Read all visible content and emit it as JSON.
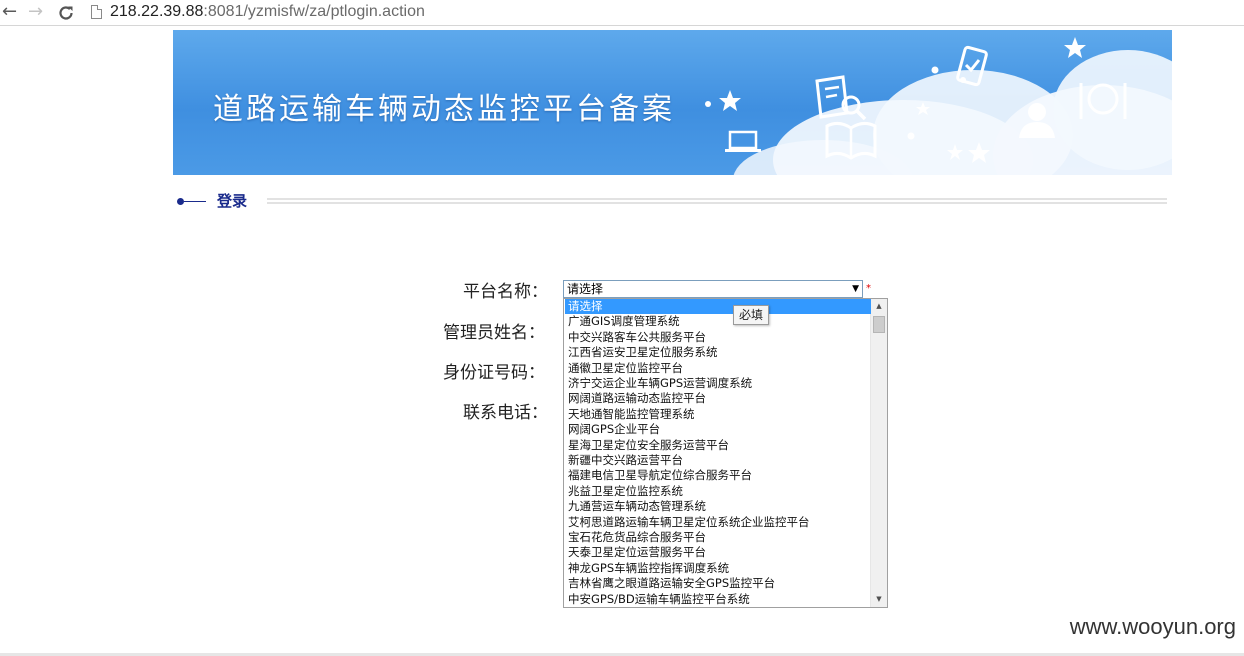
{
  "browser": {
    "url_host": "218.22.39.88",
    "url_rest": ":8081/yzmisfw/za/ptlogin.action",
    "back_icon": "arrow-left-icon",
    "forward_icon": "arrow-right-icon",
    "reload_icon": "reload-icon",
    "page_icon": "document-icon"
  },
  "banner": {
    "title": "道路运输车辆动态监控平台备案",
    "icons": [
      "star-icon",
      "laptop-icon",
      "book-icon",
      "document-search-icon",
      "phone-check-icon",
      "user-icon",
      "dining-icon"
    ]
  },
  "section": {
    "title": "登录"
  },
  "form": {
    "platform_label": "平台名称：",
    "admin_label": "管理员姓名：",
    "id_label": "身份证号码：",
    "phone_label": "联系电话：",
    "select_value": "请选择",
    "required_mark": "*",
    "tooltip": "必填",
    "options": [
      "请选择",
      "广通GIS调度管理系统",
      "中交兴路客车公共服务平台",
      "江西省运安卫星定位服务系统",
      "通徽卫星定位监控平台",
      "济宁交运企业车辆GPS运营调度系统",
      "网阔道路运输动态监控平台",
      "天地通智能监控管理系统",
      "网阔GPS企业平台",
      "星海卫星定位安全服务运营平台",
      "新疆中交兴路运营平台",
      "福建电信卫星导航定位综合服务平台",
      "兆益卫星定位监控系统",
      "九通营运车辆动态管理系统",
      "艾柯思道路运输车辆卫星定位系统企业监控平台",
      "宝石花危货品综合服务平台",
      "天泰卫星定位运营服务平台",
      "神龙GPS车辆监控指挥调度系统",
      "吉林省鹰之眼道路运输安全GPS监控平台",
      "中安GPS/BD运输车辆监控平台系统"
    ]
  },
  "watermark": "www.wooyun.org",
  "colors": {
    "banner_blue": "#3f8fe0",
    "section_navy": "#1a2b8c",
    "selected_option": "#3399ff",
    "required_red": "#e00000"
  }
}
